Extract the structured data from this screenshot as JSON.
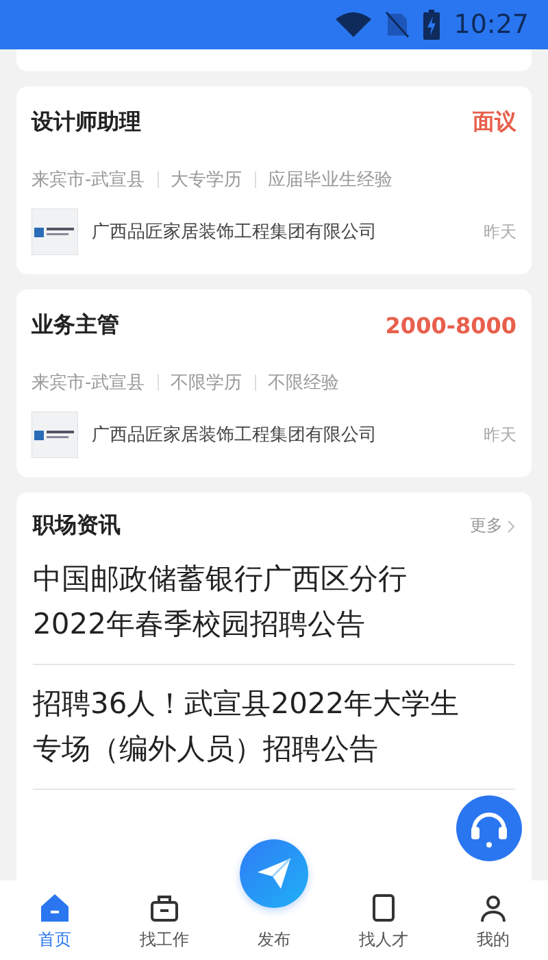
{
  "status_bar": {
    "time": "10:27"
  },
  "jobs": [
    {
      "title": "设计师助理",
      "salary": "面议",
      "tags": [
        "来宾市-武宣县",
        "大专学历",
        "应届毕业生经验"
      ],
      "company": "广西品匠家居装饰工程集团有限公司",
      "date": "昨天"
    },
    {
      "title": "业务主管",
      "salary": "2000-8000",
      "tags": [
        "来宾市-武宣县",
        "不限学历",
        "不限经验"
      ],
      "company": "广西品匠家居装饰工程集团有限公司",
      "date": "昨天"
    }
  ],
  "news": {
    "title": "职场资讯",
    "more": "更多",
    "items": [
      "中国邮政储蓄银行广西区分行2022年春季校园招聘公告",
      "招聘36人！武宣县2022年大学生专场（编外人员）招聘公告"
    ]
  },
  "tab_bar": [
    {
      "label": "首页",
      "selected": true,
      "kind": "home"
    },
    {
      "label": "找工作",
      "selected": false,
      "kind": "jobs"
    },
    {
      "label": "发布",
      "selected": false,
      "kind": "post"
    },
    {
      "label": "找人才",
      "selected": false,
      "kind": "talent"
    },
    {
      "label": "我的",
      "selected": false,
      "kind": "me"
    }
  ]
}
